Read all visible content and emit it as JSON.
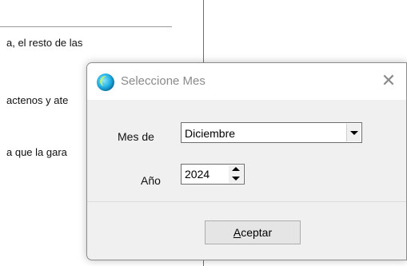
{
  "document": {
    "lines": [
      "a, el resto de las",
      "actenos y ate",
      "a que la gara"
    ]
  },
  "dialog": {
    "title": "Seleccione Mes",
    "close_glyph": "✕",
    "icon": "app-icon",
    "month_label": "Mes de",
    "month_value": "Diciembre",
    "year_label": "Año",
    "year_value": "2024",
    "accept_accel": "A",
    "accept_rest": "ceptar"
  },
  "colors": {
    "title_text": "#8a8a8a",
    "dialog_bg": "#f0f0f0",
    "button_bg": "#e5e5e5"
  }
}
